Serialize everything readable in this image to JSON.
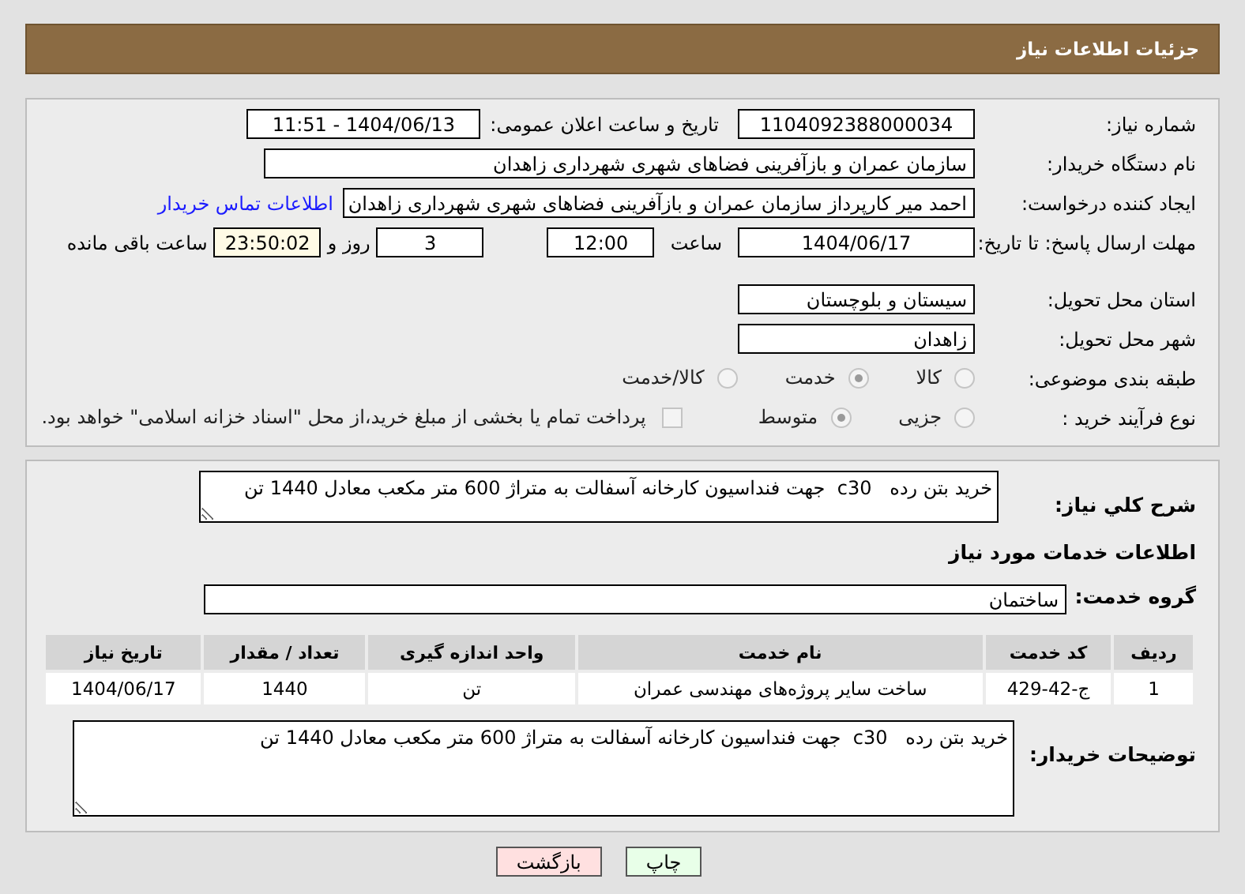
{
  "header": {
    "title": "جزئیات اطلاعات نیاز"
  },
  "need_number": {
    "label": "شماره نیاز:",
    "value": "1104092388000034"
  },
  "announce": {
    "label": "تاریخ و ساعت اعلان عمومی:",
    "value": "1404/06/13 - 11:51"
  },
  "buyer_org": {
    "label": "نام دستگاه خریدار:",
    "value": "سازمان عمران و بازآفرینی فضاهای شهری شهرداری زاهدان"
  },
  "requester": {
    "label": "ایجاد کننده درخواست:",
    "value": "احمد میر کارپرداز سازمان عمران و بازآفرینی فضاهای شهری شهرداری زاهدان",
    "link": "اطلاعات تماس خریدار"
  },
  "deadline": {
    "label": "مهلت ارسال پاسخ: تا تاریخ:",
    "date": "1404/06/17",
    "time_label": "ساعت",
    "time": "12:00",
    "days": "3",
    "days_label": "روز و",
    "remaining": "23:50:02",
    "remaining_label": "ساعت باقی مانده"
  },
  "province": {
    "label": "استان محل تحویل:",
    "value": "سیستان و بلوچستان"
  },
  "city": {
    "label": "شهر محل تحویل:",
    "value": "زاهدان"
  },
  "category": {
    "label": "طبقه بندی موضوعی:",
    "options": [
      {
        "label": "کالا",
        "selected": false
      },
      {
        "label": "خدمت",
        "selected": true
      },
      {
        "label": "کالا/خدمت",
        "selected": false
      }
    ]
  },
  "process": {
    "label": "نوع فرآیند خرید :",
    "options": [
      {
        "label": "جزیی",
        "selected": false
      },
      {
        "label": "متوسط",
        "selected": true
      }
    ],
    "payment": {
      "label": "پرداخت تمام یا بخشی از مبلغ خرید،از محل \"اسناد خزانه اسلامی\" خواهد بود.",
      "checked": false
    }
  },
  "summary": {
    "label": "شرح كلي نياز:",
    "value": "خرید بتن رده   c30  جهت فنداسیون کارخانه آسفالت به متراژ 600 متر مکعب معادل 1440 تن"
  },
  "services_title": "اطلاعات خدمات مورد نیاز",
  "service_group": {
    "label": "گروه خدمت:",
    "value": "ساختمان"
  },
  "table": {
    "columns": [
      "ردیف",
      "کد خدمت",
      "نام خدمت",
      "واحد اندازه گیری",
      "تعداد / مقدار",
      "تاریخ نیاز"
    ],
    "rows": [
      [
        "1",
        "ج-42-429",
        "ساخت سایر پروژه‌های مهندسی عمران",
        "تن",
        "1440",
        "1404/06/17"
      ]
    ]
  },
  "buyer_notes": {
    "label": "توضیحات خریدار:",
    "value": "خرید بتن رده   c30  جهت فنداسیون کارخانه آسفالت به متراژ 600 متر مکعب معادل 1440 تن"
  },
  "buttons": [
    {
      "kind": "print",
      "label": "چاپ"
    },
    {
      "kind": "back",
      "label": "بازگشت"
    }
  ]
}
